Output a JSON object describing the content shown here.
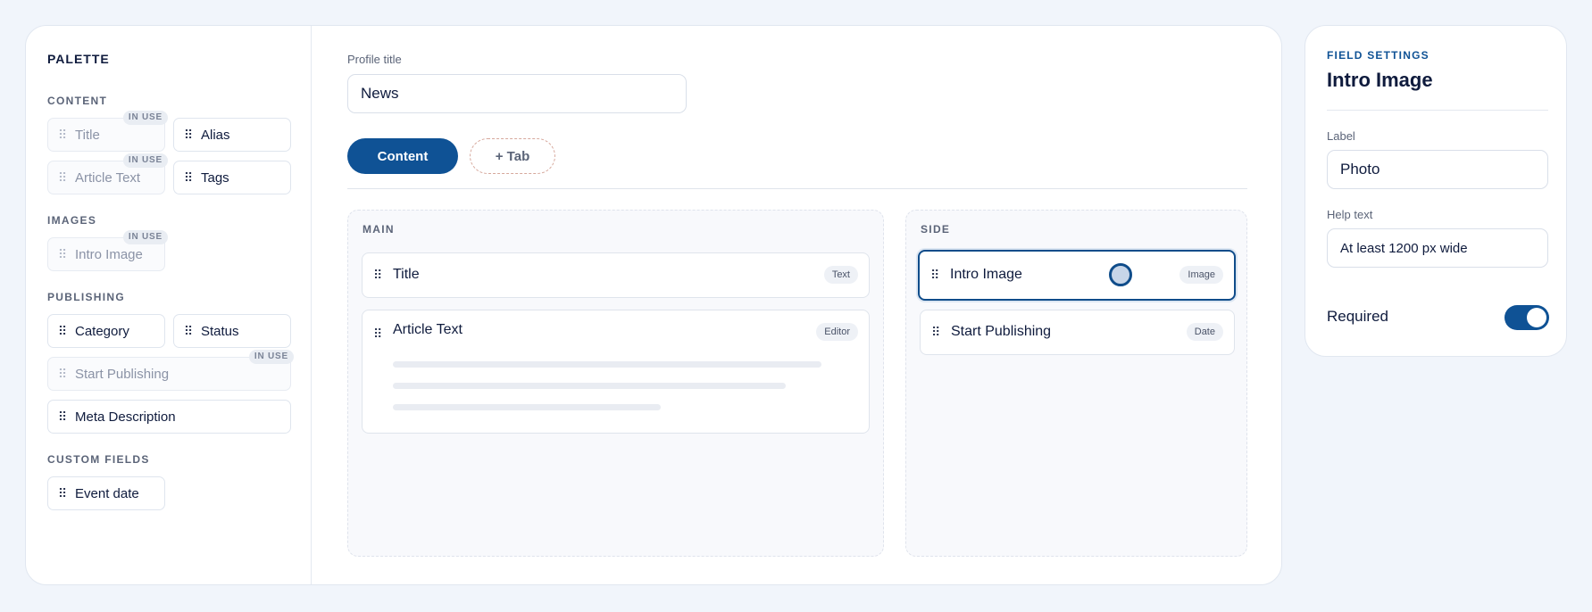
{
  "palette": {
    "title": "PALETTE",
    "sections": {
      "content": "CONTENT",
      "images": "IMAGES",
      "publishing": "PUBLISHING",
      "custom": "CUSTOM FIELDS"
    },
    "in_use_label": "IN USE",
    "items": {
      "title": "Title",
      "alias": "Alias",
      "article_text": "Article Text",
      "tags": "Tags",
      "intro_image": "Intro Image",
      "category": "Category",
      "status": "Status",
      "start_publishing": "Start Publishing",
      "meta_description": "Meta Description",
      "event_date": "Event date"
    }
  },
  "editor": {
    "profile_title_label": "Profile title",
    "profile_title_value": "News",
    "tabs": {
      "content": "Content",
      "add": "+ Tab"
    },
    "zones": {
      "main": {
        "title": "MAIN",
        "fields": [
          {
            "name": "Title",
            "type": "Text"
          },
          {
            "name": "Article Text",
            "type": "Editor"
          }
        ]
      },
      "side": {
        "title": "SIDE",
        "fields": [
          {
            "name": "Intro Image",
            "type": "Image"
          },
          {
            "name": "Start Publishing",
            "type": "Date"
          }
        ]
      }
    }
  },
  "settings": {
    "kicker": "FIELD SETTINGS",
    "title": "Intro Image",
    "label_label": "Label",
    "label_value": "Photo",
    "help_label": "Help text",
    "help_value": "At least 1200 px wide",
    "required_label": "Required",
    "required_on": true
  },
  "colors": {
    "accent": "#0f5295",
    "selected_border": "#0f4c8a",
    "background": "#f1f5fb"
  }
}
